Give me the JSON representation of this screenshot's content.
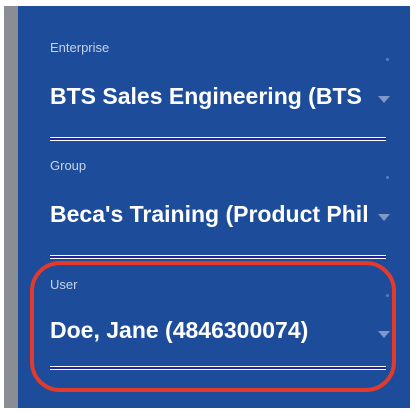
{
  "selector": {
    "enterprise": {
      "label": "Enterprise",
      "value": "BTS Sales Engineering (BTS"
    },
    "group": {
      "label": "Group",
      "value": "Beca's Training (Product Phil"
    },
    "user": {
      "label": "User",
      "value": "Doe, Jane (4846300074)"
    }
  },
  "colors": {
    "panel_background": "#1d4d9a",
    "underline": "#23239c",
    "highlight": "#e33a2c"
  },
  "icons": {
    "dropdown": "chevron-down-icon"
  }
}
